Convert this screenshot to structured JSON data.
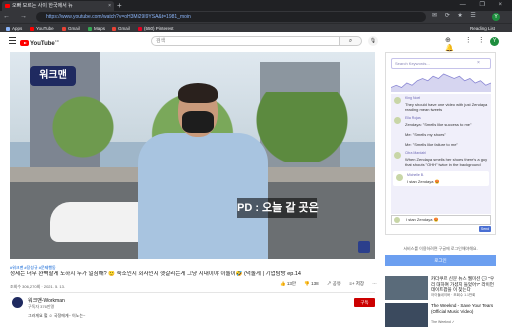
{
  "browser": {
    "tab_title": "오빠 모르는 사이 한국에서 뉴",
    "tab_close": "×",
    "new_tab": "+",
    "window_controls": "— ❐ ×",
    "nav": "← → ⟳",
    "url": "https://www.youtube.com/watch?v=oH3Mi29I9YSA&t=1981_moin",
    "ext_icons": "✉ ⟳ ★ ☰",
    "profile": "Y",
    "bookmarks": [
      {
        "label": "Apps",
        "color": "#8ab4f8"
      },
      {
        "label": "YouTube",
        "color": "#ff0000"
      },
      {
        "label": "Gmail",
        "color": "#ea4335"
      },
      {
        "label": "Maps",
        "color": "#34a853"
      },
      {
        "label": "Gmail",
        "color": "#ea4335"
      },
      {
        "label": "(550) Pinterest",
        "color": "#e60023"
      }
    ],
    "reading_list": "Reading List"
  },
  "youtube": {
    "logo_text": "YouTube",
    "region": "KR",
    "search_placeholder": "검색",
    "search_icon": "⌕",
    "mic_icon": "🎙",
    "header_icons": "⊕ ⋮⋮ 🔔",
    "user_initial": "Y"
  },
  "video": {
    "logo_overlay": "워크맨",
    "caption": "PD : 오늘 갈 곳은",
    "tags": "#워크맨 #장성규 #문제행동",
    "title": "정세는 너무 완벽할게 노하지 누가 일침해? 🙂 숙소인지 회사인지 헷갈리는게 그냥 지내이야 이놀이🤣 (덕놀게 | 기업탐방 ep.14",
    "views": "조회수 306,270회 · 2021. 5. 13.",
    "actions": [
      "👍 13만",
      "👎 138",
      "↗ 공유",
      "≡+ 저장",
      "⋯"
    ],
    "channel_name": "워크맨-Workman",
    "subscribers": "구독자 376만명",
    "subscribe_label": "구독",
    "description": "그러게요 헐 ☺ 국정에게~ 이노는~"
  },
  "chat": {
    "search_placeholder": "Search Keywords...",
    "clear_icon": "×",
    "messages": [
      {
        "user": "King Noel",
        "text": "They should have one video with just Zendaya reading mean tweets"
      },
      {
        "user": "Ella Rojas",
        "text": "Zendaya: \"Smells like success to me\""
      },
      {
        "user": "",
        "text": "Me: \"Smells my shoes\""
      },
      {
        "user": "",
        "text": "Me: \"Smells like failure to me\""
      },
      {
        "user": "Citra Mardahl",
        "text": "When Zendaya smells her shoes there's a guy that shouts \"OHH\" twice in the background"
      },
      {
        "user": "Michelle B.",
        "text": "I stan Zendaya 😍",
        "mine": true
      }
    ],
    "input_value": "I stan Zendaya 😍",
    "send_label": "Send",
    "login_note": "서비스를 이용하려면 구글에 로그인해야해요.",
    "login_button": "로그인"
  },
  "recommendations": [
    {
      "title": "카더쿠르 신문 뉴스 웹미션 💬 \"우리 대하여 가셨지 들었어?\" 라이언 데이트팝을 이 찾는다",
      "meta": "아이돌네이버 · 조회수 1.1만회"
    },
    {
      "title": "The Weeknd - Save Your Tears (Official Music Video)",
      "meta": "The Weeknd ✓"
    }
  ],
  "chart_data": {
    "type": "area",
    "values": [
      2,
      3,
      2,
      4,
      3,
      5,
      6,
      5,
      7,
      6,
      8,
      7,
      6,
      7,
      5,
      6,
      4,
      5,
      3,
      4
    ],
    "color": "#8a87d4"
  }
}
